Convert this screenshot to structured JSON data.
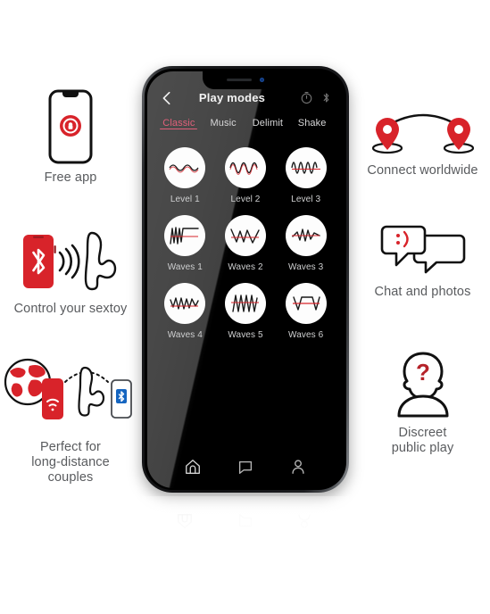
{
  "brand": {
    "accent_red": "#d8232a",
    "accent_pink": "#e0607a",
    "screen_black": "#000000",
    "label_gray": "#595b5e",
    "mode_label_gray": "#cfd0d1"
  },
  "features_left": [
    {
      "id": "free-app",
      "label": "Free app",
      "icon": "phone-with-app-icon",
      "sub_icons": [
        "smartphone-outline",
        "red-circle-lock-badge"
      ]
    },
    {
      "id": "control-sextoy",
      "label": "Control your sextoy",
      "icon": "red-phone-bluetooth-signal-toy",
      "sub_icons": [
        "red-smartphone",
        "bluetooth-icon",
        "signal-waves-icon",
        "sextoy-outline-icon"
      ]
    },
    {
      "id": "long-distance",
      "label": "Perfect for\nlong-distance\ncouples",
      "icon": "globe-phone-toy-phone",
      "sub_icons": [
        "globe-icon",
        "red-smartphone-wifi-icon",
        "sextoy-outline-icon",
        "bluetooth-phone-icon",
        "dotted-arc-icon"
      ]
    }
  ],
  "features_right": [
    {
      "id": "connect-worldwide",
      "label": "Connect worldwide",
      "icon": "two-map-pins-arc",
      "sub_icons": [
        "map-pin-icon",
        "map-pin-icon",
        "connection-arc-icon"
      ]
    },
    {
      "id": "chat-photos",
      "label": "Chat and photos",
      "icon": "speech-bubbles",
      "sub_icons": [
        "speech-bubble-icon",
        "speech-bubble-icon"
      ],
      "bubble_text": ";)"
    },
    {
      "id": "discreet-play",
      "label": "Discreet\npublic play",
      "icon": "anonymous-person-question",
      "sub_icons": [
        "person-silhouette-icon",
        "question-mark-icon"
      ],
      "badge_text": "?"
    }
  ],
  "phone": {
    "header": {
      "back_icon": "chevron-left-icon",
      "title": "Play modes",
      "right_icons": [
        "timer-icon",
        "bluetooth-icon"
      ]
    },
    "tabs": [
      {
        "label": "Classic",
        "active": true
      },
      {
        "label": "Music",
        "active": false
      },
      {
        "label": "Delimit",
        "active": false
      },
      {
        "label": "Shake",
        "active": false
      }
    ],
    "modes": [
      {
        "label": "Level 1",
        "pattern": "gentle-sine-low"
      },
      {
        "label": "Level 2",
        "pattern": "sine-medium"
      },
      {
        "label": "Level 3",
        "pattern": "sine-high-frequency"
      },
      {
        "label": "Waves 1",
        "pattern": "zigzag-then-flat"
      },
      {
        "label": "Waves 2",
        "pattern": "wide-zigzag-descending"
      },
      {
        "label": "Waves 3",
        "pattern": "sharp-zigzag-burst"
      },
      {
        "label": "Waves 4",
        "pattern": "zigzag-fade"
      },
      {
        "label": "Waves 5",
        "pattern": "dense-triangle-wave"
      },
      {
        "label": "Waves 6",
        "pattern": "trapezoid-plateau"
      }
    ],
    "bottom_nav": [
      {
        "icon": "home-icon",
        "active": true
      },
      {
        "icon": "chat-bubble-icon",
        "active": false
      },
      {
        "icon": "profile-icon",
        "active": false
      }
    ]
  }
}
